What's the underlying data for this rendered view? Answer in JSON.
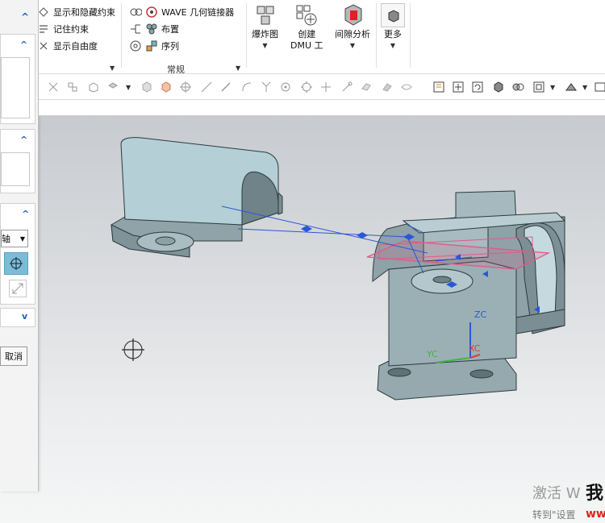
{
  "ribbon": {
    "group1": {
      "items": [
        "显示和隐藏约束",
        "记住约束",
        "显示自由度"
      ]
    },
    "group2": {
      "items": [
        "WAVE 几何链接器",
        "布置",
        "序列"
      ],
      "label": "常规"
    },
    "big_buttons": [
      {
        "label": "爆炸图",
        "icon": "exploded-view-icon"
      },
      {
        "label": "创建",
        "label2": "DMU 工",
        "icon": "create-dmu-icon"
      },
      {
        "label": "间隙分析",
        "icon": "clearance-analysis-icon"
      },
      {
        "label": "更多",
        "icon": "more-icon"
      }
    ]
  },
  "dialog": {
    "select_value": "轴",
    "cancel_label": "取消"
  },
  "viewport": {
    "axis_labels": {
      "zc": "ZC",
      "yc": "YC",
      "xc": "XC"
    }
  },
  "watermark": {
    "line1": "激活 W",
    "line2": "转到\"设置"
  },
  "brand": {
    "line1": "我",
    "line2": "ww"
  },
  "colors": {
    "part_face": "#9fb3b7",
    "part_light": "#c9dde3",
    "constraint_blue": "#2a56d8",
    "plane_pink": "#e05a8a"
  }
}
